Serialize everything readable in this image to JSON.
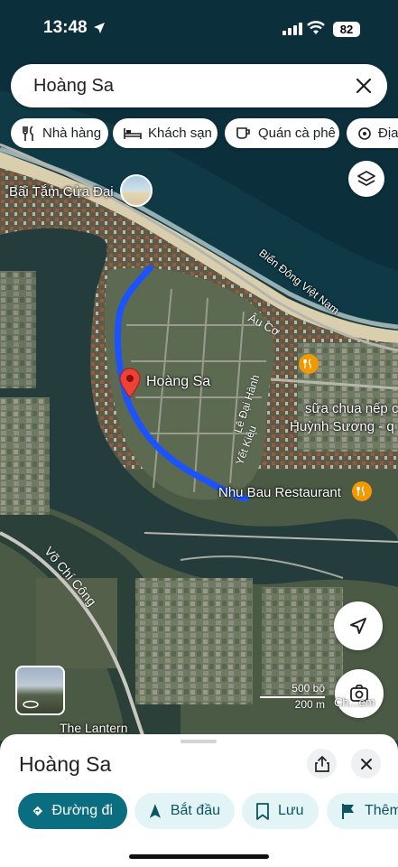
{
  "status_bar": {
    "time": "13:48",
    "battery": "82"
  },
  "search": {
    "query": "Hoàng Sa"
  },
  "chips": [
    {
      "label": "Nhà hàng",
      "icon": "fork-knife-icon"
    },
    {
      "label": "Khách sạn",
      "icon": "bed-icon"
    },
    {
      "label": "Quán cà phê",
      "icon": "coffee-cup-icon"
    },
    {
      "label": "Địa",
      "icon": "landmark-icon"
    }
  ],
  "map": {
    "labels": {
      "beach": "Bãi Tắm Cửa Đại",
      "sea": "Biển Đông Việt Nam",
      "selected_place": "Hoàng Sa",
      "restaurant": "Nhu Bau Restaurant",
      "yogurt_line1": "sữa chua nếp c",
      "yogurt_line2": "Huỳnh Sương - q",
      "lantern": "The Lantern"
    },
    "roads": {
      "au_co": "Âu Cơ",
      "le_dai_hanh": "Lê Đại Hành",
      "yet_kieu": "Yết Kiêu",
      "vo_chi_cong": "Võ Chí Công"
    },
    "scale": {
      "imperial": "500 bộ",
      "metric": "200 m"
    },
    "lens_label": "Ch...em",
    "colors": {
      "route": "#1a53ff",
      "pin": "#ea4335",
      "food_pin": "#f29900"
    }
  },
  "sheet": {
    "title": "Hoàng Sa",
    "actions": [
      {
        "label": "Đường đi",
        "icon": "directions-icon",
        "style": "primary"
      },
      {
        "label": "Bắt đầu",
        "icon": "navigation-arrow-icon",
        "style": "secondary"
      },
      {
        "label": "Lưu",
        "icon": "bookmark-icon",
        "style": "secondary"
      },
      {
        "label": "Thêm",
        "icon": "flag-icon",
        "style": "secondary"
      }
    ]
  }
}
